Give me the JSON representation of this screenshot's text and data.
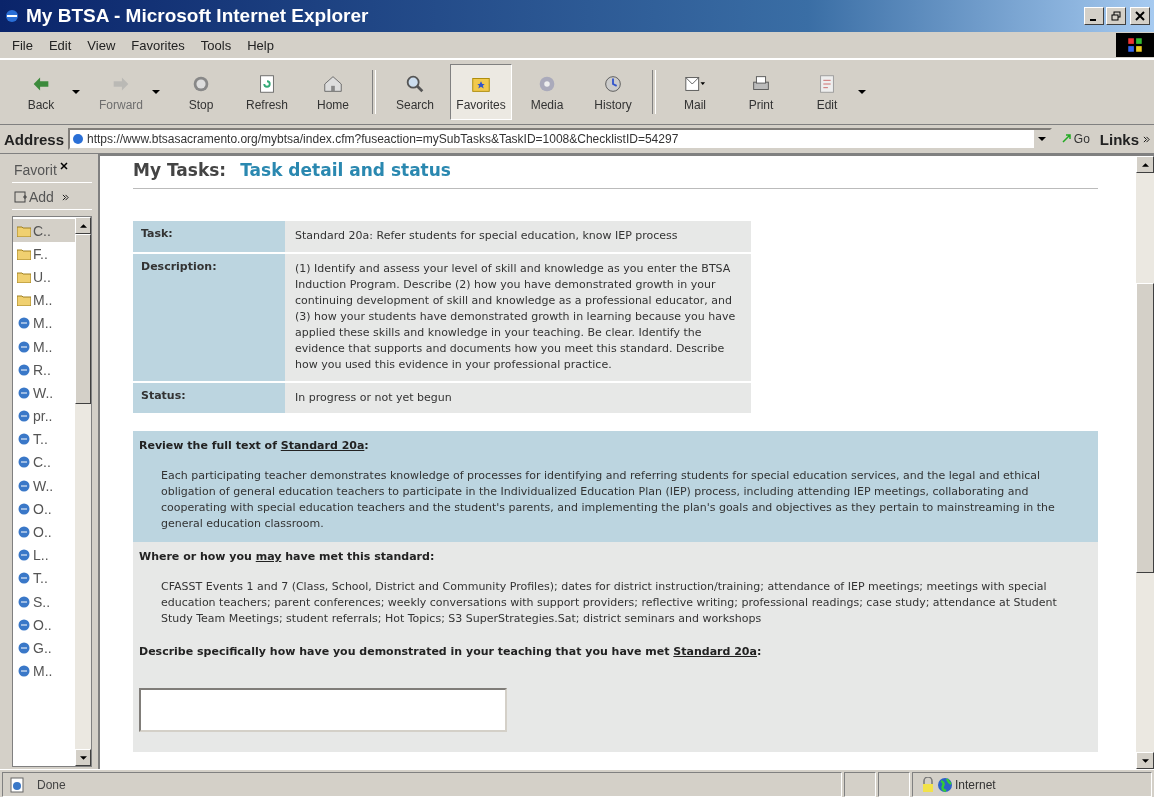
{
  "window": {
    "title": "My BTSA - Microsoft Internet Explorer"
  },
  "menu": [
    "File",
    "Edit",
    "View",
    "Favorites",
    "Tools",
    "Help"
  ],
  "toolbar": [
    {
      "label": "Back",
      "kind": "back",
      "disabled": false,
      "selected": false,
      "dropdown": true
    },
    {
      "label": "Forward",
      "kind": "forward",
      "disabled": true,
      "selected": false,
      "dropdown": true
    },
    {
      "label": "Stop",
      "kind": "stop",
      "disabled": false,
      "selected": false,
      "dropdown": false
    },
    {
      "label": "Refresh",
      "kind": "refresh",
      "disabled": false,
      "selected": false,
      "dropdown": false
    },
    {
      "label": "Home",
      "kind": "home",
      "disabled": false,
      "selected": false,
      "dropdown": false
    },
    {
      "label": "Search",
      "kind": "search",
      "disabled": false,
      "selected": false,
      "dropdown": false
    },
    {
      "label": "Favorites",
      "kind": "favorites",
      "disabled": false,
      "selected": true,
      "dropdown": false
    },
    {
      "label": "Media",
      "kind": "media",
      "disabled": false,
      "selected": false,
      "dropdown": false
    },
    {
      "label": "History",
      "kind": "history",
      "disabled": false,
      "selected": false,
      "dropdown": false
    },
    {
      "label": "Mail",
      "kind": "mail",
      "disabled": false,
      "selected": false,
      "dropdown": false
    },
    {
      "label": "Print",
      "kind": "print",
      "disabled": false,
      "selected": false,
      "dropdown": false
    },
    {
      "label": "Edit",
      "kind": "edit",
      "disabled": false,
      "selected": false,
      "dropdown": true
    }
  ],
  "address": {
    "label": "Address",
    "url": "https://www.btsasacramento.org/mybtsa/index.cfm?fuseaction=mySubTasks&TaskID=1008&ChecklistID=54297",
    "go": "Go",
    "links": "Links"
  },
  "favorites": {
    "title": "Favorit",
    "add": "Add",
    "items": [
      {
        "label": "C..",
        "kind": "folder",
        "selected": true
      },
      {
        "label": "F..",
        "kind": "folder",
        "selected": false
      },
      {
        "label": "U..",
        "kind": "folder",
        "selected": false
      },
      {
        "label": "M..",
        "kind": "folder",
        "selected": false
      },
      {
        "label": "M..",
        "kind": "page",
        "selected": false
      },
      {
        "label": "M..",
        "kind": "page",
        "selected": false
      },
      {
        "label": "R..",
        "kind": "page",
        "selected": false
      },
      {
        "label": "W..",
        "kind": "page",
        "selected": false
      },
      {
        "label": "pr..",
        "kind": "page",
        "selected": false
      },
      {
        "label": "T..",
        "kind": "page",
        "selected": false
      },
      {
        "label": "C..",
        "kind": "page",
        "selected": false
      },
      {
        "label": "W..",
        "kind": "page",
        "selected": false
      },
      {
        "label": "O..",
        "kind": "page",
        "selected": false
      },
      {
        "label": "O..",
        "kind": "page",
        "selected": false
      },
      {
        "label": "L..",
        "kind": "page",
        "selected": false
      },
      {
        "label": "T..",
        "kind": "page",
        "selected": false
      },
      {
        "label": "S..",
        "kind": "page",
        "selected": false
      },
      {
        "label": "O..",
        "kind": "page",
        "selected": false
      },
      {
        "label": "G..",
        "kind": "page",
        "selected": false
      },
      {
        "label": "M..",
        "kind": "page",
        "selected": false
      }
    ]
  },
  "page": {
    "heading": "My Tasks:",
    "subheading": "Task detail and status",
    "details": [
      {
        "label": "Task:",
        "value": "Standard 20a: Refer students for special education, know IEP process"
      },
      {
        "label": "Description:",
        "value": "(1) Identify and assess your level of skill and knowledge as you enter the BTSA Induction Program. Describe (2) how you have demonstrated growth in your continuing development of skill and knowledge as a professional educator, and (3) how your students have demonstrated growth in learning because you have applied these skills and knowledge in your teaching. Be clear. Identify the evidence that supports and documents how you meet this standard. Describe how you used this evidence in your professional practice."
      },
      {
        "label": "Status:",
        "value": "In progress or not yet begun"
      }
    ],
    "sections": [
      {
        "kind": "highlight",
        "title": [
          {
            "kind": "plain",
            "text": "Review the full text of "
          },
          {
            "kind": "link",
            "text": "Standard 20a"
          },
          {
            "kind": "plain",
            "text": ":"
          }
        ],
        "text": "Each participating teacher demonstrates knowledge of processes for identifying and referring students for special education services, and the legal and ethical obligation of general education teachers to participate in the Individualized Education Plan (IEP) process, including attending IEP meetings, collaborating and cooperating with special education teachers and the student's parents, and implementing the plan's goals and objectives as they pertain to mainstreaming in the general education classroom."
      },
      {
        "kind": "plain",
        "title": [
          {
            "kind": "plain",
            "text": "Where or how you "
          },
          {
            "kind": "underline",
            "text": "may"
          },
          {
            "kind": "plain",
            "text": " have met this standard:"
          }
        ],
        "text": "CFASST Events 1 and 7 (Class, School, District and Community Profiles); dates for district instruction/training; attendance of IEP meetings; meetings with special education teachers; parent conferences; weekly conversations with support providers; reflective writing; professional readings; case study; attendance at Student Study Team Meetings; student referrals; Hot Topics; S3 SuperStrategies.Sat; district seminars and workshops"
      },
      {
        "kind": "answer",
        "title": [
          {
            "kind": "plain",
            "text": "Describe specifically how have you demonstrated in your teaching that you have met "
          },
          {
            "kind": "link",
            "text": "Standard 20a"
          },
          {
            "kind": "plain",
            "text": ":"
          }
        ]
      }
    ]
  },
  "status_bar": {
    "status": "Done",
    "zone": "Internet"
  }
}
